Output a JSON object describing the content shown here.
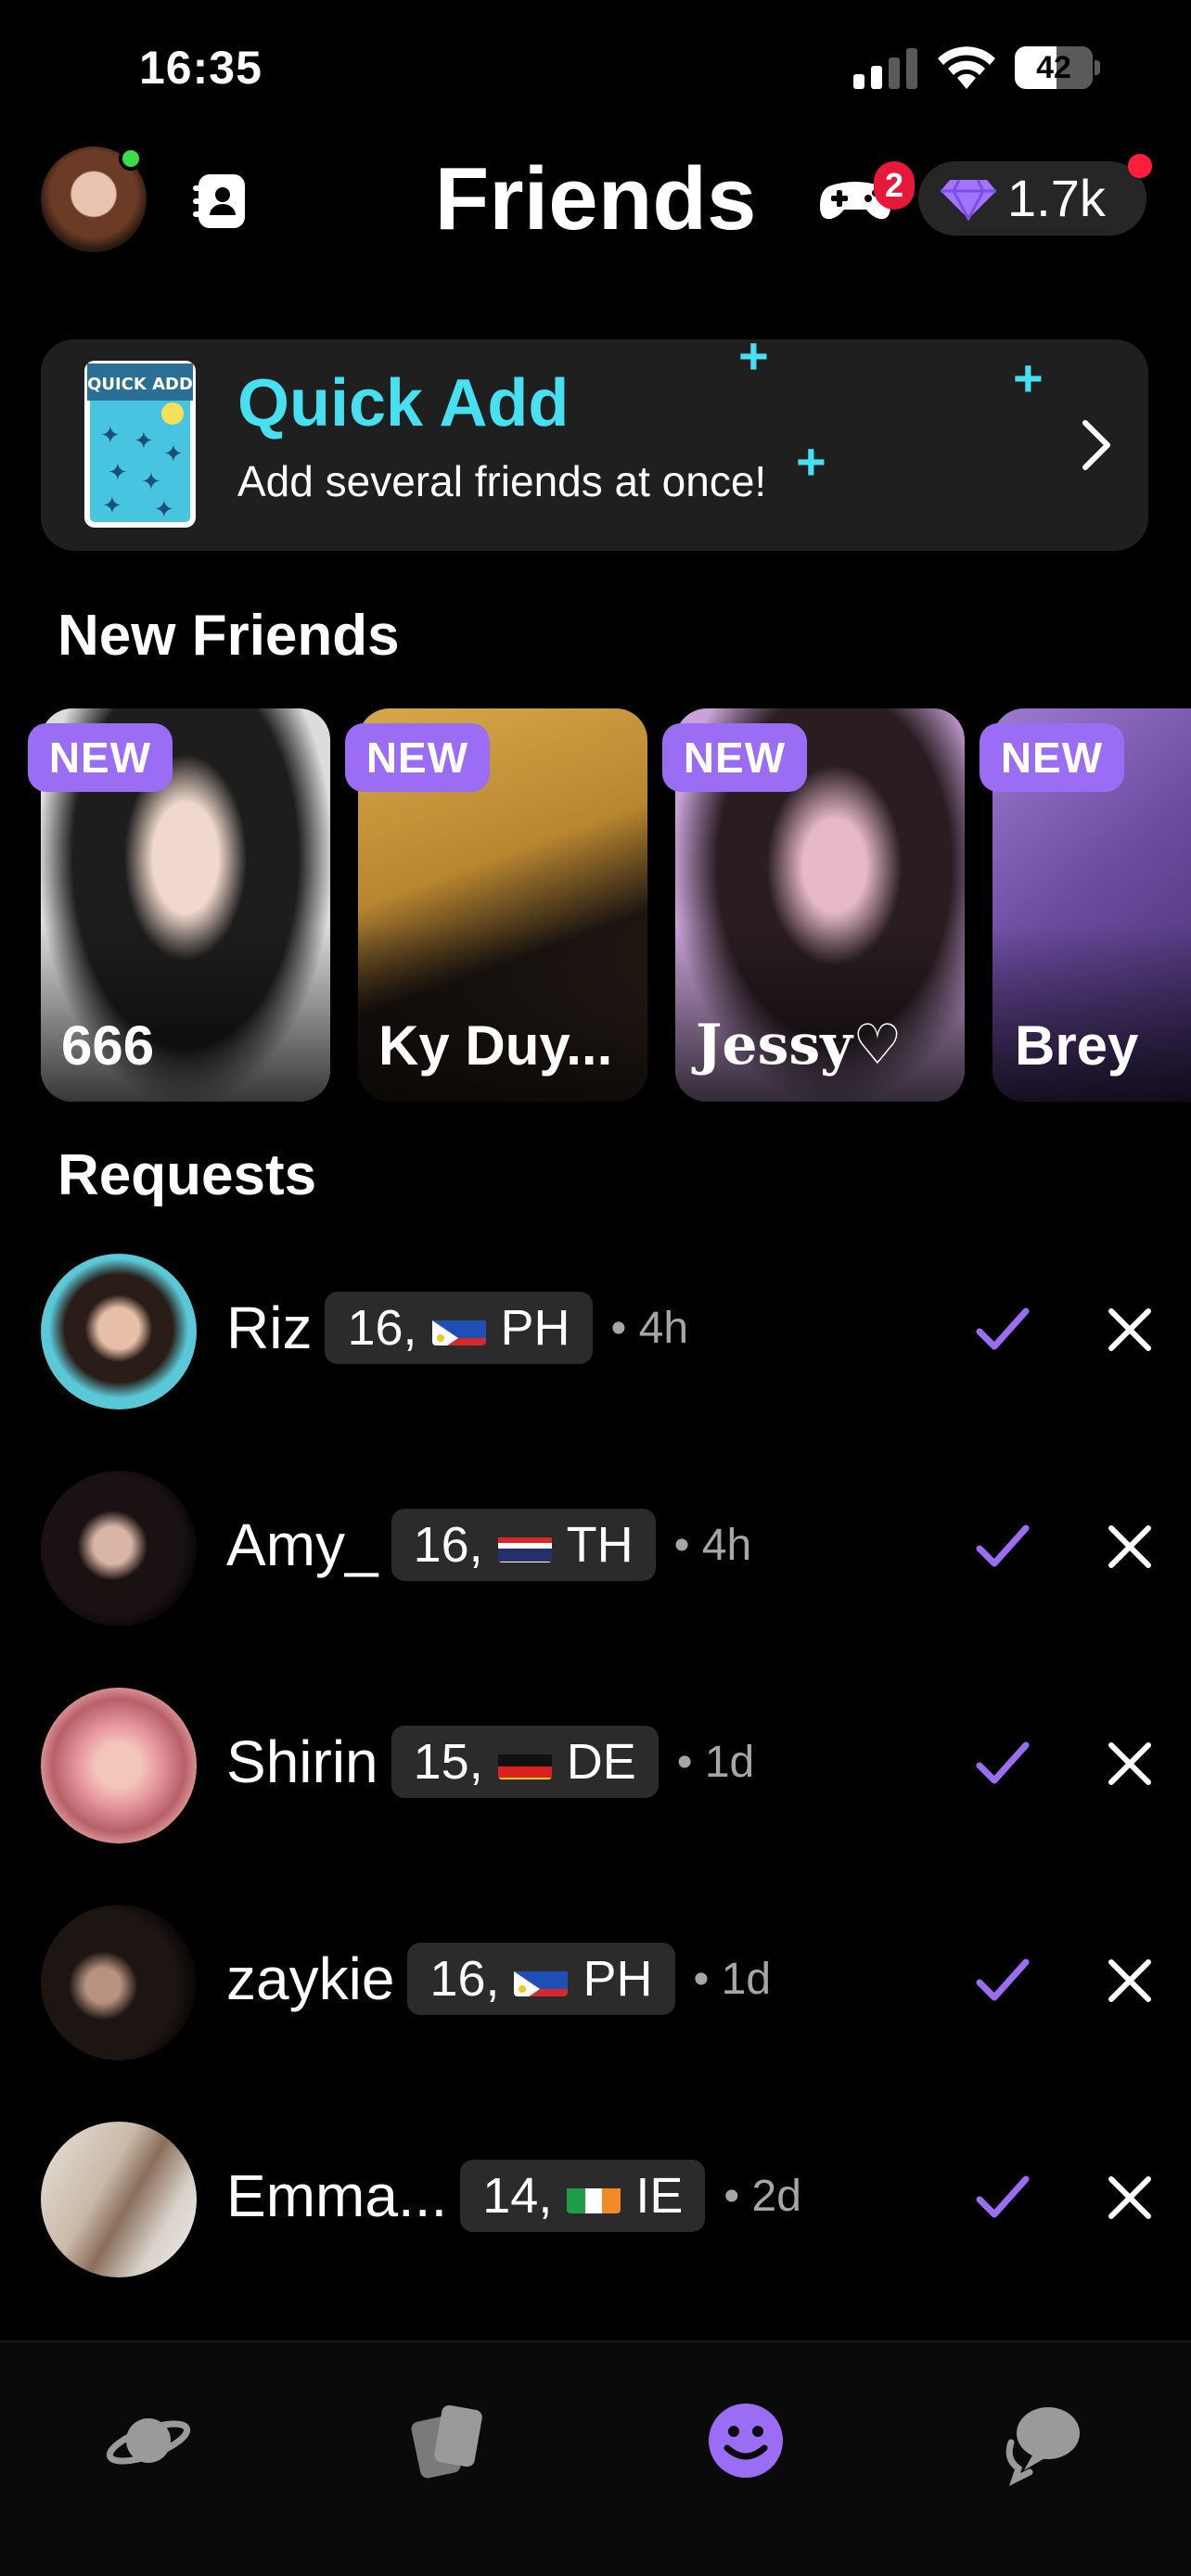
{
  "status_bar": {
    "time": "16:35",
    "battery": "42",
    "battery_level": 0.42
  },
  "header": {
    "title": "Friends",
    "game_badge": "2",
    "gems": "1.7k"
  },
  "quick_add": {
    "title": "Quick Add",
    "subtitle": "Add several friends at once!",
    "illustration_label": "QUICK ADD"
  },
  "new_friends": {
    "heading": "New Friends",
    "badge_label": "NEW",
    "items": [
      {
        "name": "666"
      },
      {
        "name": "Ky Duy..."
      },
      {
        "name": "Jessy♡"
      },
      {
        "name": "Brey"
      }
    ]
  },
  "requests": {
    "heading": "Requests",
    "items": [
      {
        "name": "Riz",
        "age": "16,",
        "country": "PH",
        "time": "• 4h"
      },
      {
        "name": "Amy_",
        "age": "16,",
        "country": "TH",
        "time": "• 4h"
      },
      {
        "name": "Shirin",
        "age": "15,",
        "country": "DE",
        "time": "• 1d"
      },
      {
        "name": "zaykie",
        "age": "16,",
        "country": "PH",
        "time": "• 1d"
      },
      {
        "name": "Emma...",
        "age": "14,",
        "country": "IE",
        "time": "• 2d"
      }
    ]
  },
  "tabs": [
    {
      "icon": "planet-icon"
    },
    {
      "icon": "cards-icon"
    },
    {
      "icon": "smiley-icon",
      "active": true
    },
    {
      "icon": "chat-icon"
    }
  ],
  "colors": {
    "accent_purple": "#9b6df5",
    "quick_add_cyan": "#47e0f0",
    "badge_red": "#e8183a"
  }
}
